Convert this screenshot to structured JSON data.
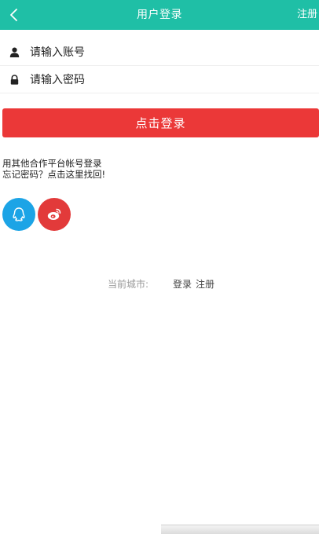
{
  "header": {
    "title": "用户登录",
    "register_label": "注册",
    "back_icon": "chevron-left-icon"
  },
  "form": {
    "account": {
      "icon": "user-icon",
      "placeholder": "请输入账号",
      "value": ""
    },
    "password": {
      "icon": "lock-icon",
      "placeholder": "请输入密码",
      "value": ""
    },
    "login_button_label": "点击登录"
  },
  "other_login": {
    "text": "用其他合作平台帐号登录",
    "forgot_password": "忘记密码？点击这里找回!"
  },
  "social": {
    "qq_icon": "qq-icon",
    "weibo_icon": "weibo-icon",
    "qq_color": "#1ca4e6",
    "weibo_color": "#e23a3a"
  },
  "footer": {
    "city_label": "当前城市:",
    "login_label": "登录",
    "register_label": "注册"
  },
  "colors": {
    "accent": "#1fbfa6",
    "primary_button": "#eb3838"
  }
}
